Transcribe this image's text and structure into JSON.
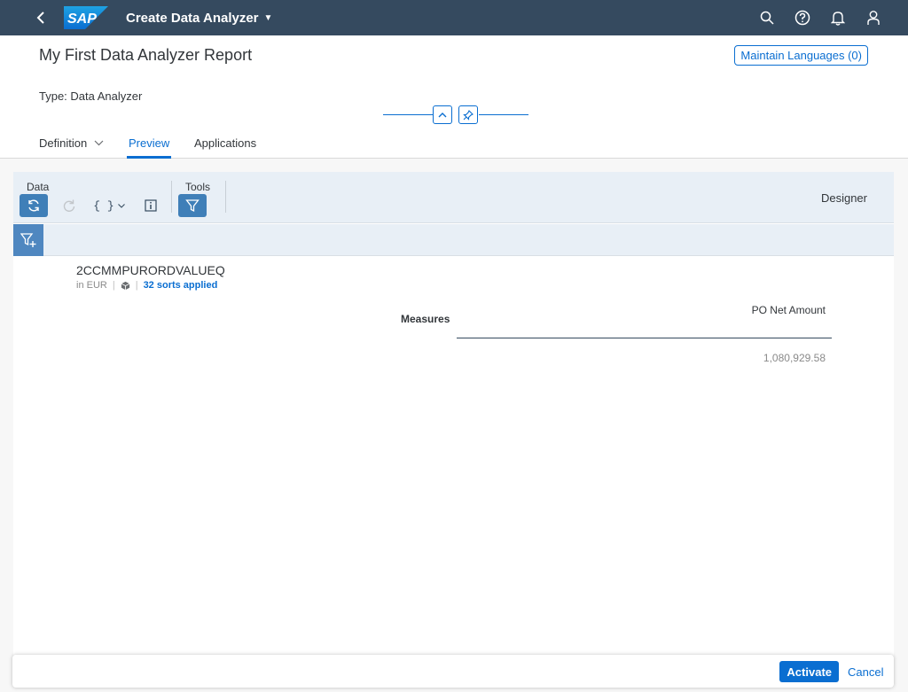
{
  "shell": {
    "logo_text": "SAP",
    "app_title": "Create Data Analyzer"
  },
  "header": {
    "title": "My First Data Analyzer Report",
    "maintain_languages": "Maintain Languages (0)",
    "type_line": "Type: Data Analyzer"
  },
  "tabs": [
    {
      "label": "Definition",
      "has_dropdown": true
    },
    {
      "label": "Preview",
      "active": true
    },
    {
      "label": "Applications"
    }
  ],
  "toolbar": {
    "data_label": "Data",
    "tools_label": "Tools",
    "variables_glyph": "{ }",
    "designer": "Designer"
  },
  "report": {
    "datasource": "2CCMMPURORDVALUEQ",
    "currency": "in EUR",
    "sorts": "32 sorts applied",
    "row_header": "Measures",
    "column_header": "PO Net Amount",
    "value": "1,080,929.58"
  },
  "footer": {
    "activate": "Activate",
    "cancel": "Cancel"
  },
  "colors": {
    "shell": "#354a5f",
    "accent": "#0a6ed1",
    "toolbar": "#e8eff6"
  }
}
